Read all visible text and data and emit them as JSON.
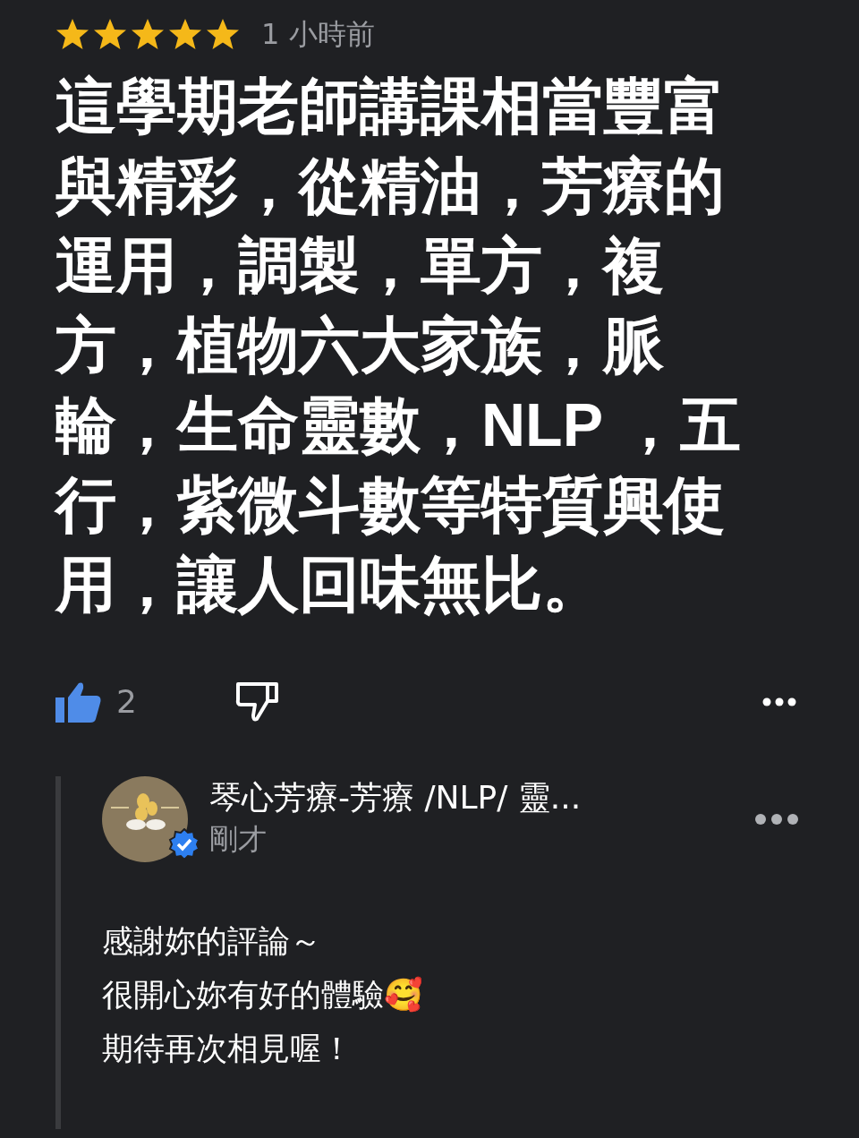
{
  "review": {
    "stars": 5,
    "time": "1 小時前",
    "text": "這學期老師講課相當豐富與精彩，從精油，芳療的運用，調製，單方，複方，植物六大家族，脈輪，生命靈數，NLP ，五行，紫微斗數等特質興使用，讓人回味無比。",
    "likes": "2"
  },
  "reply": {
    "author": "琴心芳療-芳療 /NLP/ 靈...",
    "verified": true,
    "time": "剛才",
    "lines": [
      "感謝妳的評論～",
      "很開心妳有好的體驗🥰",
      "期待再次相見喔！"
    ]
  }
}
